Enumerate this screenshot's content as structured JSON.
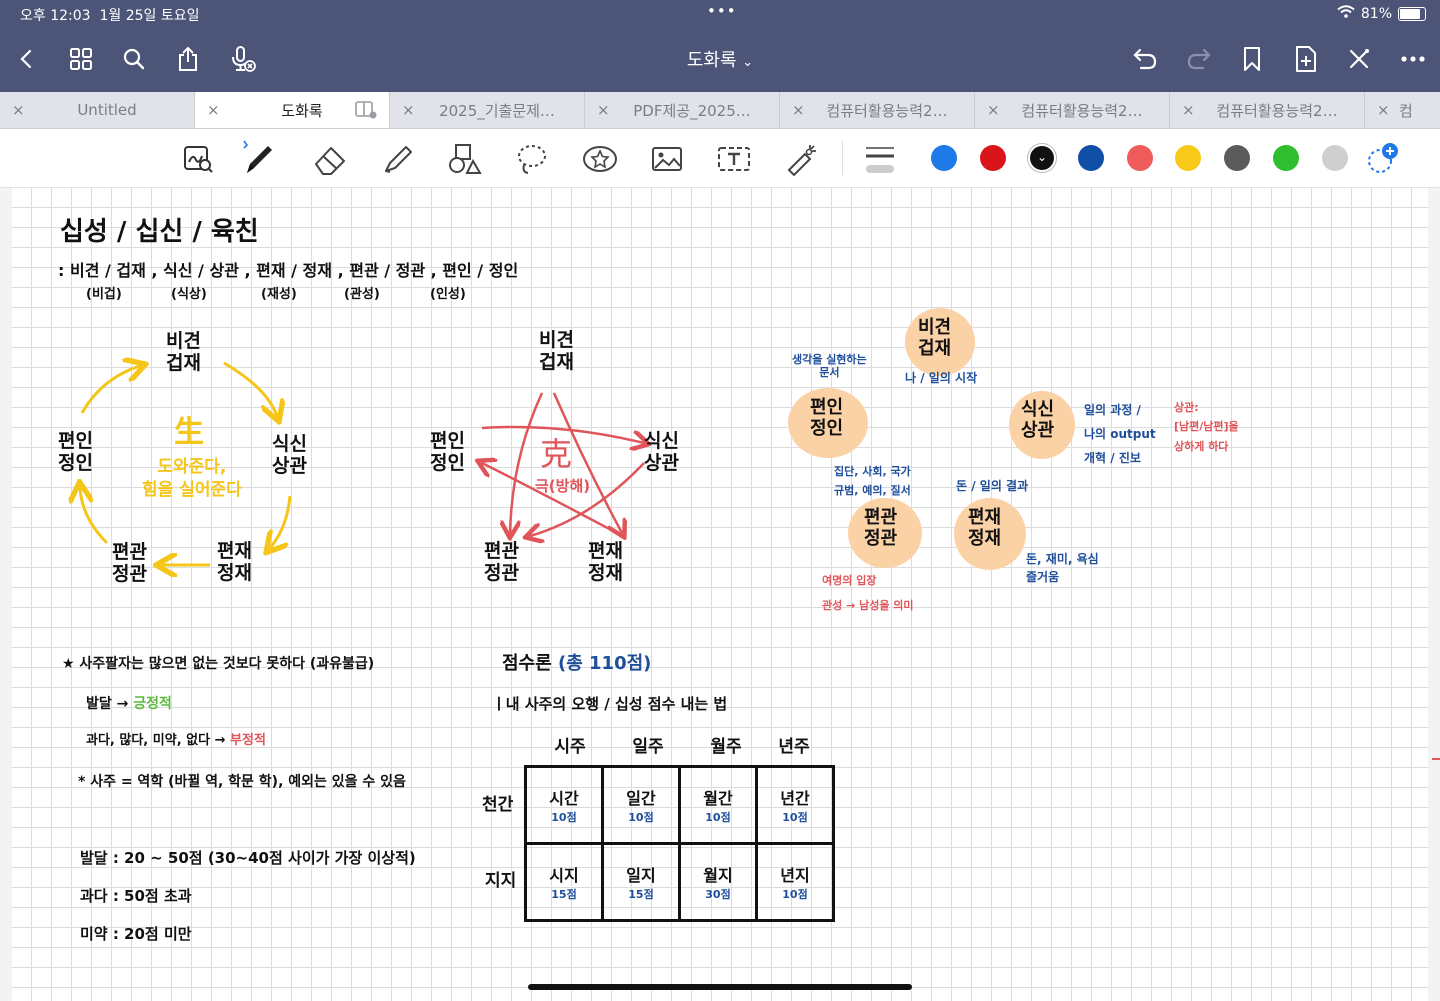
{
  "status": {
    "time": "오후 12:03",
    "date": "1월 25일 토요일",
    "dots": "•••",
    "battery": "81%"
  },
  "header": {
    "title": "도화록",
    "chevron": "⌄"
  },
  "tabs": [
    {
      "label": "Untitled",
      "close": "×"
    },
    {
      "label": "도화록",
      "close": "×"
    },
    {
      "label": "2025_기출문제…",
      "close": "×"
    },
    {
      "label": "PDF제공_2025…",
      "close": "×"
    },
    {
      "label": "컴퓨터활용능력2…",
      "close": "×"
    },
    {
      "label": "컴퓨터활용능력2…",
      "close": "×"
    },
    {
      "label": "컴퓨터활용능력2…",
      "close": "×"
    },
    {
      "label": "컴",
      "close": "×"
    }
  ],
  "colors": {
    "swatches": [
      "#1e7ae6",
      "#d9151b",
      "#111111",
      "#0f4fa8",
      "#ef5b5b",
      "#f8c918",
      "#5b5b5b",
      "#2fbe2f",
      "#cfcfcf"
    ],
    "selected_swatch": 2
  },
  "note": {
    "title": "십성 / 십신 / 육친",
    "subtitle_line": ": 비견 / 겁재 , 식신 / 상관 , 편재 / 정재 , 편관 / 정관 , 편인 / 정인",
    "subtitle_groups": [
      "(비겁)",
      "(식상)",
      "(재성)",
      "(관성)",
      "(인성)"
    ],
    "cycle_left": {
      "top": [
        "비견",
        "겁재"
      ],
      "right": [
        "식신",
        "상관"
      ],
      "bottom_right": [
        "편재",
        "정재"
      ],
      "bottom_left": [
        "편관",
        "정관"
      ],
      "left": [
        "편인",
        "정인"
      ],
      "center_char": "生",
      "center_lines": [
        "도와준다,",
        "힘을 실어준다"
      ]
    },
    "cycle_middle": {
      "top": [
        "비견",
        "겁재"
      ],
      "right": [
        "식신",
        "상관"
      ],
      "bottom_right": [
        "편재",
        "정재"
      ],
      "bottom_left": [
        "편관",
        "정관"
      ],
      "left": [
        "편인",
        "정인"
      ],
      "center_char": "克",
      "center_line": "극(방해)"
    },
    "right_map": {
      "bigyeon": [
        "비견",
        "겁재"
      ],
      "bigyeon_note": "나 / 일의 시작",
      "pyeonin": [
        "편인",
        "정인"
      ],
      "pyeonin_note": [
        "생각을 실현하는",
        "문서"
      ],
      "siksin": [
        "식신",
        "상관"
      ],
      "siksin_notes": [
        "일의 과정 /",
        "나의 output",
        "개혁 / 진보"
      ],
      "sanggwan_notes": [
        "상관:",
        "[남편/남편]을",
        "상하게 하다"
      ],
      "pyeongwan": [
        "편관",
        "정관"
      ],
      "pyeongwan_notes_top": [
        "집단, 사회, 국가",
        "규범, 예의, 질서"
      ],
      "pyeongwan_notes_bottom": [
        "여명의 입장",
        "관성 → 남성을 의미"
      ],
      "pyeonjae": [
        "편재",
        "정재"
      ],
      "pyeonjae_note_top": "돈 / 일의 결과",
      "pyeonjae_notes_bottom": [
        "돈, 재미, 욕심",
        "즐거움"
      ]
    },
    "bottom_left": {
      "line1": "★ 사주팔자는 많으면 없는 것보다 못하다 (과유불급)",
      "line2_prefix": "발달 →",
      "line2_suffix": "긍정적",
      "line3_prefix": "과다, 많다, 미약, 없다 →",
      "line3_suffix": "부정적",
      "line4": "* 사주 = 역학 (바뀔 역, 학문 학), 예외는 있을 수 있음",
      "line5": "발달 : 20 ~ 50점  (30~40점 사이가 가장 이상적)",
      "line6": "과다 : 50점 초과",
      "line7": "미약 : 20점  미만"
    },
    "score": {
      "title_black": "점수론",
      "title_blue": "(총 110점)",
      "subtitle": "ㅣ내 사주의 오행 / 십성  점수 내는 법",
      "columns": [
        "시주",
        "일주",
        "월주",
        "년주"
      ],
      "rows": [
        "천간",
        "지지"
      ],
      "cells": [
        [
          {
            "name": "시간",
            "score": "10점"
          },
          {
            "name": "일간",
            "score": "10점"
          },
          {
            "name": "월간",
            "score": "10점"
          },
          {
            "name": "년간",
            "score": "10점"
          }
        ],
        [
          {
            "name": "시지",
            "score": "15점"
          },
          {
            "name": "일지",
            "score": "15점"
          },
          {
            "name": "월지",
            "score": "30점"
          },
          {
            "name": "년지",
            "score": "10점"
          }
        ]
      ]
    }
  }
}
